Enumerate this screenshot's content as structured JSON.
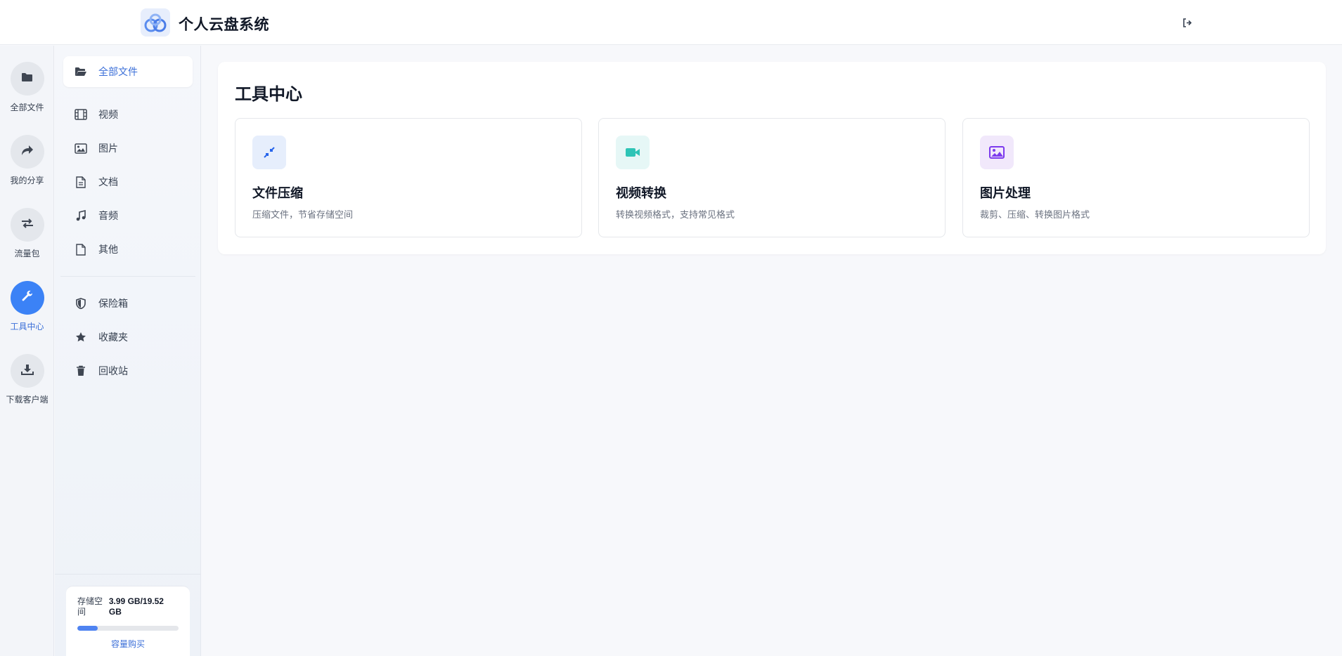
{
  "header": {
    "app_title": "个人云盘系统",
    "logo_icon": "cloud-logo-icon",
    "logout_icon": "sign-out-icon"
  },
  "rail": {
    "items": [
      {
        "label": "全部文件",
        "icon": "folder-icon"
      },
      {
        "label": "我的分享",
        "icon": "share-icon"
      },
      {
        "label": "流量包",
        "icon": "exchange-icon"
      },
      {
        "label": "工具中心",
        "icon": "wrench-icon",
        "active": true
      },
      {
        "label": "下载客户端",
        "icon": "download-icon"
      }
    ]
  },
  "sidebar": {
    "items": [
      {
        "label": "全部文件",
        "icon": "folder-open-icon",
        "active": true
      },
      {
        "label": "视频",
        "icon": "film-icon"
      },
      {
        "label": "图片",
        "icon": "image-icon"
      },
      {
        "label": "文档",
        "icon": "file-text-icon"
      },
      {
        "label": "音频",
        "icon": "music-icon"
      },
      {
        "label": "其他",
        "icon": "file-icon"
      }
    ],
    "secondary_items": [
      {
        "label": "保险箱",
        "icon": "shield-icon"
      },
      {
        "label": "收藏夹",
        "icon": "star-icon"
      },
      {
        "label": "回收站",
        "icon": "trash-icon"
      }
    ],
    "storage": {
      "label": "存储空间",
      "value": "3.99 GB/19.52 GB",
      "used_fraction": 0.204,
      "buy_label": "容量购买"
    }
  },
  "main": {
    "title": "工具中心",
    "tools": [
      {
        "title": "文件压缩",
        "desc": "压缩文件，节省存储空间",
        "icon": "compress-icon",
        "color": "#2563eb",
        "bg": "#e6eefc"
      },
      {
        "title": "视频转换",
        "desc": "转换视频格式，支持常见格式",
        "icon": "video-camera-icon",
        "color": "#2ec4b6",
        "bg": "#e6f7f6"
      },
      {
        "title": "图片处理",
        "desc": "裁剪、压缩、转换图片格式",
        "icon": "image-icon",
        "color": "#7c3aed",
        "bg": "#f1e8fb"
      }
    ]
  },
  "colors": {
    "accent": "#3b82f6",
    "accent_text": "#3b6fd8"
  }
}
